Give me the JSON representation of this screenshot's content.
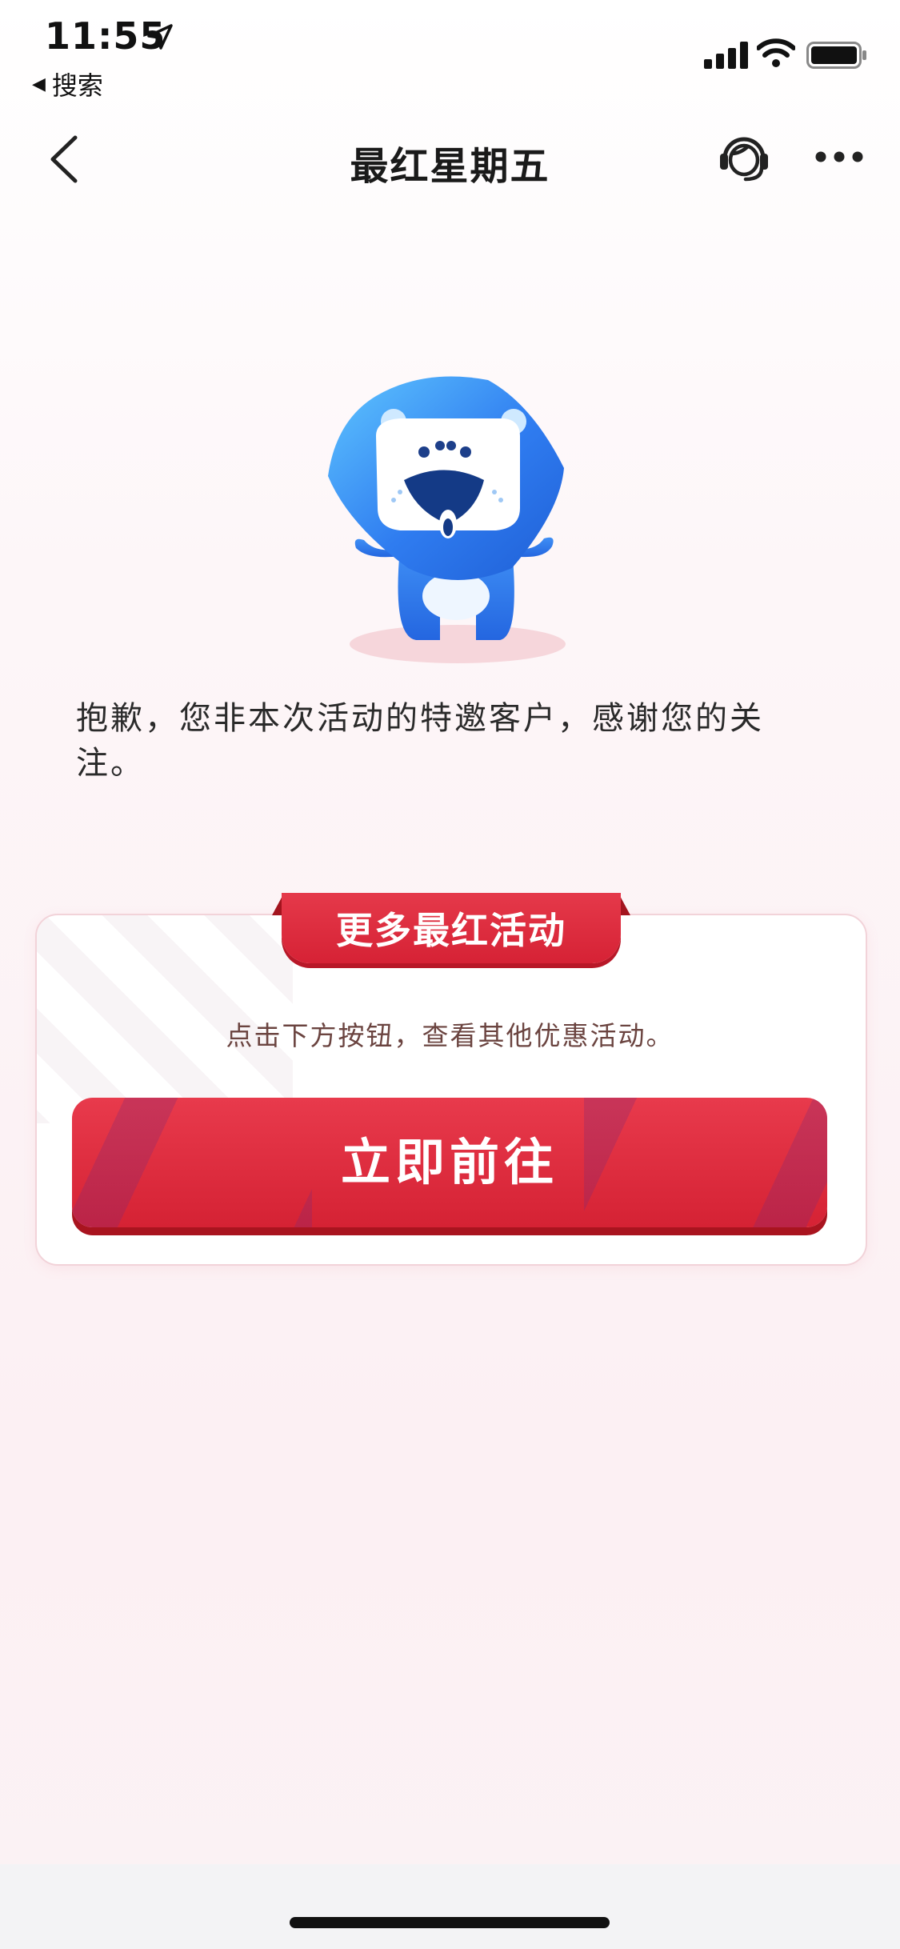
{
  "status_bar": {
    "time": "11:55",
    "back_app_label": "搜索",
    "icons": [
      "location-arrow-icon",
      "signal-icon",
      "wifi-icon",
      "battery-icon"
    ]
  },
  "nav": {
    "title": "最红星期五",
    "icons": [
      "back-chevron-icon",
      "customer-service-icon",
      "more-dots-icon"
    ]
  },
  "message": "抱歉，您非本次活动的特邀客户，感谢您的关注。",
  "card": {
    "ribbon_title": "更多最红活动",
    "hint": "点击下方按钮，查看其他优惠活动。",
    "button_label": "立即前往"
  },
  "colors": {
    "accent_red": "#d62235",
    "mascot_blue": "#2f7cf0",
    "hint_brown": "#6b4440"
  }
}
